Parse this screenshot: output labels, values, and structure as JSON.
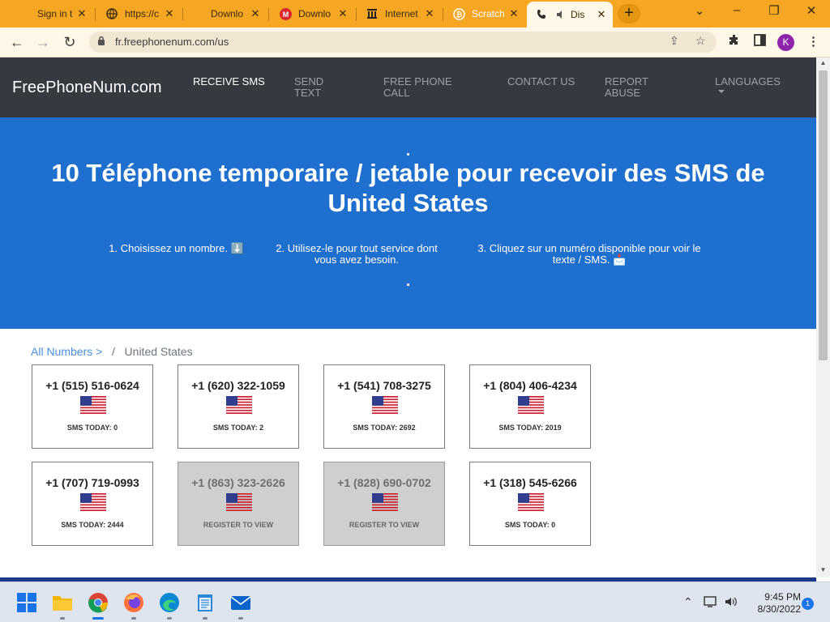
{
  "browser": {
    "tabs": [
      {
        "title": "Sign in t",
        "icon": "microsoft-icon"
      },
      {
        "title": "https://c",
        "icon": "globe-icon"
      },
      {
        "title": "Downlo",
        "icon": "microsoft-icon"
      },
      {
        "title": "Downlo",
        "icon": "mega-icon"
      },
      {
        "title": "Internet",
        "icon": "archive-icon"
      },
      {
        "title": "Scratch",
        "icon": "bitcoin-icon"
      },
      {
        "title": "Dis",
        "icon": "phone-icon"
      }
    ],
    "url": "fr.freephonenum.com/us",
    "profile_initial": "K"
  },
  "site": {
    "brand": "FreePhoneNum.com",
    "nav": [
      {
        "label": "Receive SMS",
        "active": true
      },
      {
        "label": "Send Text",
        "active": false
      },
      {
        "label": "Free Phone Call",
        "active": false
      },
      {
        "label": "Contact Us",
        "active": false
      },
      {
        "label": "Report Abuse",
        "active": false
      },
      {
        "label": "Languages",
        "active": false
      }
    ]
  },
  "hero": {
    "title": "10 Téléphone temporaire / jetable pour recevoir des SMS de United States",
    "steps": [
      "1. Choisissez un nombre. ⬇️",
      "2. Utilisez-le pour tout service dont vous avez besoin.",
      "3. Cliquez sur un numéro disponible pour voir le texte / SMS. 📩"
    ]
  },
  "breadcrumb": {
    "link": "All Numbers >",
    "separator": "/",
    "current": "United States"
  },
  "numbers": [
    {
      "number": "+1 (515) 516-0624",
      "status": "SMS TODAY: 0",
      "locked": false
    },
    {
      "number": "+1 (620) 322-1059",
      "status": "SMS TODAY: 2",
      "locked": false
    },
    {
      "number": "+1 (541) 708-3275",
      "status": "SMS TODAY: 2692",
      "locked": false
    },
    {
      "number": "+1 (804) 406-4234",
      "status": "SMS TODAY: 2019",
      "locked": false
    },
    {
      "number": "+1 (707) 719-0993",
      "status": "SMS TODAY: 2444",
      "locked": false
    },
    {
      "number": "+1 (863) 323-2626",
      "status": "REGISTER TO VIEW",
      "locked": true
    },
    {
      "number": "+1 (828) 690-0702",
      "status": "REGISTER TO VIEW",
      "locked": true
    },
    {
      "number": "+1 (318) 545-6266",
      "status": "SMS TODAY: 0",
      "locked": false
    }
  ],
  "taskbar": {
    "apps": [
      "start-icon",
      "file-explorer-icon",
      "chrome-icon",
      "firefox-icon",
      "edge-icon",
      "notepad-icon",
      "mail-icon"
    ],
    "time": "9:45 PM",
    "date": "8/30/2022",
    "notification_count": "1"
  },
  "colors": {
    "tabstrip": "#f5a623",
    "navbar": "#343a40",
    "hero": "#1f6fcf",
    "link": "#4a8fe0"
  }
}
